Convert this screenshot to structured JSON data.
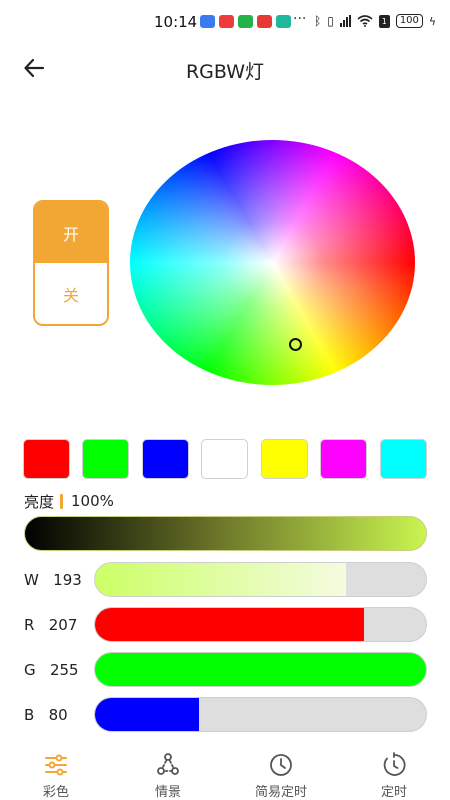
{
  "status_bar": {
    "time": "10:14",
    "more": "···",
    "sim": "1",
    "battery": "100"
  },
  "header": {
    "title": "RGBW灯"
  },
  "power": {
    "on_label": "开",
    "off_label": "关",
    "state": "on",
    "accent_color": "#f2a735"
  },
  "presets": [
    {
      "name": "red",
      "color": "#ff0000"
    },
    {
      "name": "green",
      "color": "#00ff00"
    },
    {
      "name": "blue",
      "color": "#0000ff"
    },
    {
      "name": "white",
      "color": "#ffffff"
    },
    {
      "name": "yellow",
      "color": "#ffff00"
    },
    {
      "name": "magenta",
      "color": "#ff00ff"
    },
    {
      "name": "cyan",
      "color": "#00ffff"
    }
  ],
  "brightness": {
    "label": "亮度",
    "value": "100%",
    "percent": 100
  },
  "channels": [
    {
      "letter": "W",
      "value": 193,
      "display": "193",
      "fill_color": "#ccff66",
      "fill_style": "gradient"
    },
    {
      "letter": "R",
      "value": 207,
      "display": "207",
      "fill_color": "#ff0000",
      "fill_style": "solid"
    },
    {
      "letter": "G",
      "value": 255,
      "display": "255",
      "fill_color": "#00ff00",
      "fill_style": "solid"
    },
    {
      "letter": "B",
      "value": 80,
      "display": "80",
      "fill_color": "#0000ff",
      "fill_style": "solid"
    }
  ],
  "channel_max": 255,
  "nav": {
    "items": [
      {
        "label": "彩色",
        "icon": "sliders-icon",
        "active": true
      },
      {
        "label": "情景",
        "icon": "scene-icon",
        "active": false
      },
      {
        "label": "简易定时",
        "icon": "clock-icon",
        "active": false
      },
      {
        "label": "定时",
        "icon": "timer-icon",
        "active": false
      }
    ]
  }
}
